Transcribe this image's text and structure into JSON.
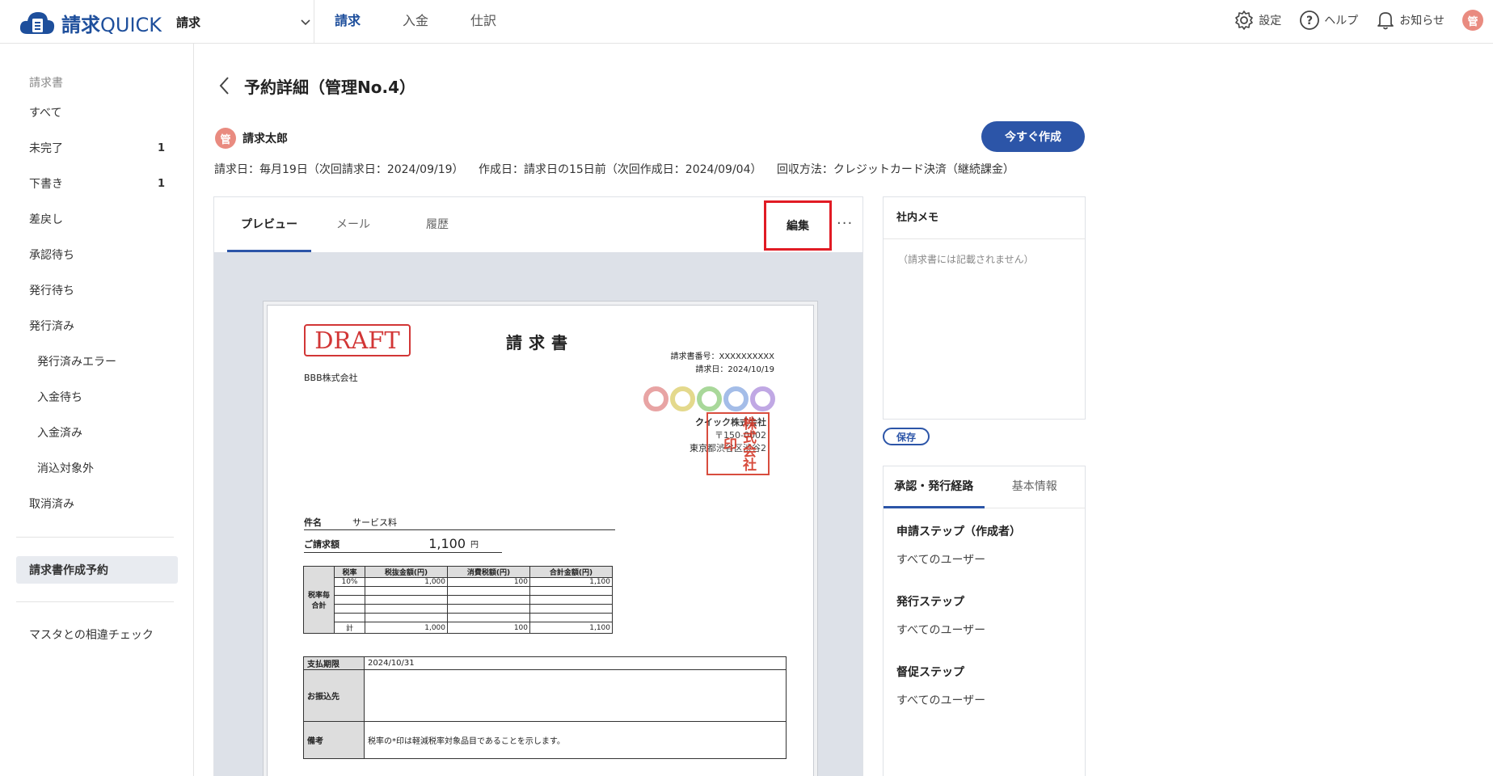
{
  "app": {
    "logo_main": "請求",
    "logo_sub": "QUICK"
  },
  "module_select": {
    "value": "請求"
  },
  "main_nav": [
    {
      "label": "請求",
      "active": true
    },
    {
      "label": "入金",
      "active": false
    },
    {
      "label": "仕訳",
      "active": false
    }
  ],
  "top_right": {
    "settings": "設定",
    "help": "ヘルプ",
    "notifications": "お知らせ",
    "avatar": "管"
  },
  "sidebar": {
    "heading": "請求書",
    "items": [
      {
        "label": "すべて",
        "count": ""
      },
      {
        "label": "未完了",
        "count": "1"
      },
      {
        "label": "下書き",
        "count": "1"
      },
      {
        "label": "差戻し",
        "count": ""
      },
      {
        "label": "承認待ち",
        "count": ""
      },
      {
        "label": "発行待ち",
        "count": ""
      },
      {
        "label": "発行済み",
        "count": ""
      },
      {
        "label": "発行済みエラー",
        "count": ""
      },
      {
        "label": "入金待ち",
        "count": ""
      },
      {
        "label": "入金済み",
        "count": ""
      },
      {
        "label": "消込対象外",
        "count": ""
      },
      {
        "label": "取消済み",
        "count": ""
      }
    ],
    "reservation": "請求書作成予約",
    "master_check": "マスタとの相違チェック"
  },
  "page": {
    "title": "予約詳細（管理No.4）",
    "user_avatar": "管",
    "user_name": "請求太郎",
    "create_now": "今すぐ作成",
    "schedule": {
      "billing_day": "請求日：毎月19日（次回請求日：2024/09/19）",
      "create_day": "作成日：請求日の15日前（次回作成日：2024/09/04）",
      "collection": "回収方法：クレジットカード決済（継続課金）"
    }
  },
  "preview_tabs": {
    "preview": "プレビュー",
    "mail": "メール",
    "history": "履歴",
    "edit": "編集",
    "more": "···"
  },
  "invoice": {
    "draft": "DRAFT",
    "title": "請求書",
    "number": "請求書番号：XXXXXXXXXX",
    "date": "請求日：2024/10/19",
    "customer": "BBB株式会社",
    "issuer_name": "クイック株式会社",
    "issuer_zip": "〒150-0002",
    "issuer_addr": "東京都渋谷区渋谷2",
    "seal_text": "株式会社印",
    "subject_label": "件名",
    "subject_value": "サービス料",
    "amount_label": "ご請求額",
    "amount_value": "1,100",
    "amount_unit": "円",
    "tax_label": "税率毎合計",
    "tax_headers": [
      "税率",
      "税抜金額(円)",
      "消費税額(円)",
      "合計金額(円)"
    ],
    "tax_row": [
      "10%",
      "1,000",
      "100",
      "1,100"
    ],
    "tax_total": [
      "計",
      "1,000",
      "100",
      "1,100"
    ],
    "due_label": "支払期限",
    "due_value": "2024/10/31",
    "bank_label": "お振込先",
    "note_label": "備考",
    "note_value": "税率の*印は軽減税率対象品目であることを示します。",
    "circle_colors": [
      "#e8a4a4",
      "#e4d98c",
      "#a9d89a",
      "#a4bde8",
      "#c0a8e4"
    ]
  },
  "memo": {
    "title": "社内メモ",
    "placeholder": "（請求書には記載されません）",
    "save": "保存"
  },
  "approval": {
    "tab_route": "承認・発行経路",
    "tab_info": "基本情報",
    "steps": [
      {
        "name": "申請ステップ（作成者）",
        "user": "すべてのユーザー"
      },
      {
        "name": "発行ステップ",
        "user": "すべてのユーザー"
      },
      {
        "name": "督促ステップ",
        "user": "すべてのユーザー"
      }
    ]
  }
}
